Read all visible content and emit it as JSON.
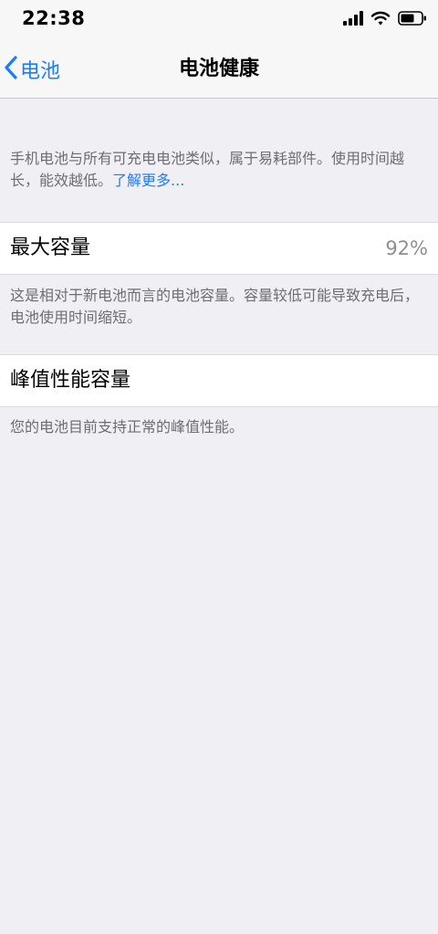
{
  "status_bar": {
    "time": "22:38",
    "icons": [
      "cellular-signal-icon",
      "wifi-icon",
      "battery-icon"
    ]
  },
  "nav": {
    "back_label": "电池",
    "title": "电池健康"
  },
  "intro": {
    "text": "手机电池与所有可充电电池类似，属于易耗部件。使用时间越长，能效越低。",
    "link": "了解更多..."
  },
  "max_capacity": {
    "label": "最大容量",
    "value": "92%",
    "footer": "这是相对于新电池而言的电池容量。容量较低可能导致充电后，电池使用时间缩短。"
  },
  "peak_performance": {
    "label": "峰值性能容量",
    "footer": "您的电池目前支持正常的峰值性能。"
  },
  "colors": {
    "accent": "#1A7EF6",
    "background": "#EFEFF4",
    "secondary_text": "#6D6D72"
  }
}
